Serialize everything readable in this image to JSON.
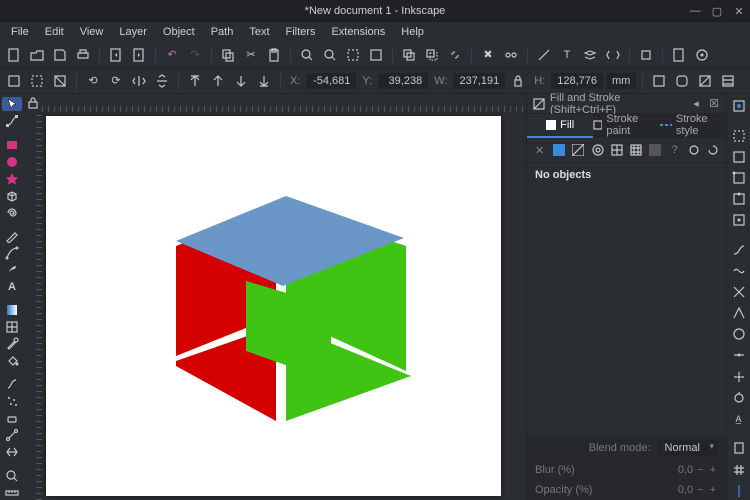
{
  "window": {
    "title": "*New document 1 - Inkscape"
  },
  "menu": [
    "File",
    "Edit",
    "View",
    "Layer",
    "Object",
    "Path",
    "Text",
    "Filters",
    "Extensions",
    "Help"
  ],
  "coords": {
    "x_label": "X:",
    "x": "-54,681",
    "y_label": "Y:",
    "y": "39,238",
    "w_label": "W:",
    "w": "237,191",
    "h_label": "H:",
    "h": "128,776",
    "unit": "mm"
  },
  "panel": {
    "title": "Fill and Stroke (Shift+Ctrl+F)",
    "tabs": {
      "fill": "Fill",
      "stroke_paint": "Stroke paint",
      "stroke_style": "Stroke style"
    },
    "no_objects": "No objects",
    "blend_label": "Blend mode:",
    "blend_value": "Normal",
    "blur_label": "Blur (%)",
    "blur_value": "0,0",
    "opacity_label": "Opacity (%)",
    "opacity_value": "0,0"
  }
}
